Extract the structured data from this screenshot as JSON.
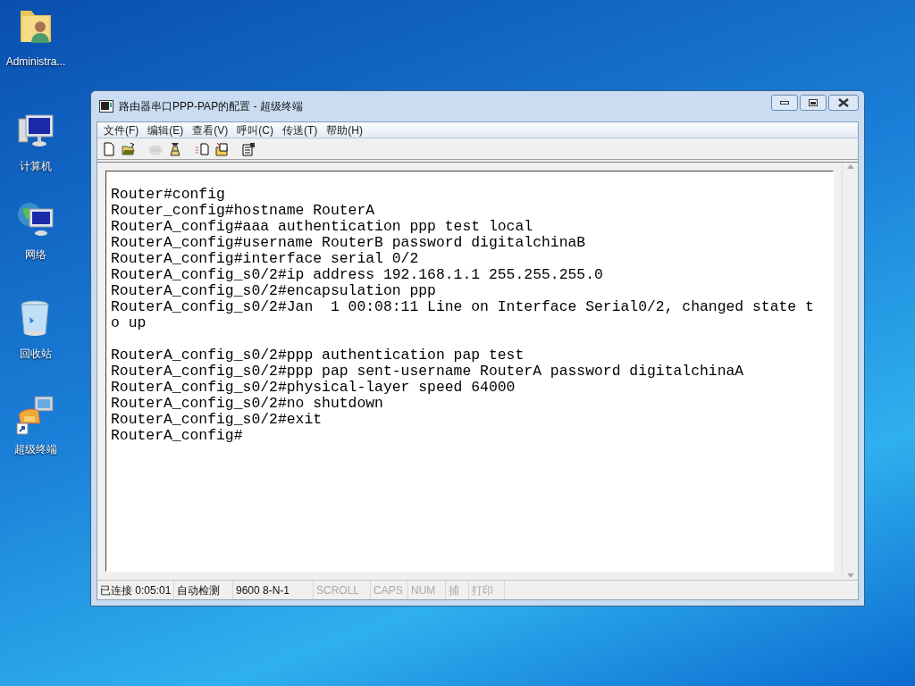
{
  "desktop_icons": [
    {
      "kind": "user-folder",
      "label": "Administra..."
    },
    {
      "kind": "computer",
      "label": "计算机"
    },
    {
      "kind": "network",
      "label": "网络"
    },
    {
      "kind": "recycle-bin",
      "label": "回收站"
    },
    {
      "kind": "terminal-shortcut",
      "label": "超级终端"
    }
  ],
  "window": {
    "title": "路由器串口PPP-PAP的配置 - 超级终端"
  },
  "menu": [
    "文件(F)",
    "编辑(E)",
    "查看(V)",
    "呼叫(C)",
    "传送(T)",
    "帮助(H)"
  ],
  "toolbar": [
    {
      "kind": "new",
      "disabled": false
    },
    {
      "kind": "open",
      "disabled": false
    },
    {
      "kind": "disconnect",
      "disabled": true
    },
    {
      "kind": "call",
      "disabled": false
    },
    {
      "kind": "send",
      "disabled": false
    },
    {
      "kind": "receive",
      "disabled": false
    },
    {
      "kind": "properties",
      "disabled": false
    }
  ],
  "terminal": {
    "lines": [
      {
        "text": "Router#config",
        "gap_before": true
      },
      {
        "text": "Router_config#hostname RouterA",
        "gap_before": false
      },
      {
        "text": "RouterA_config#aaa authentication ppp test local",
        "gap_before": false
      },
      {
        "text": "RouterA_config#username RouterB password digitalchinaB",
        "gap_before": false
      },
      {
        "text": "RouterA_config#interface serial 0/2",
        "gap_before": false
      },
      {
        "text": "RouterA_config_s0/2#ip address 192.168.1.1 255.255.255.0",
        "gap_before": false
      },
      {
        "text": "RouterA_config_s0/2#encapsulation ppp",
        "gap_before": false
      },
      {
        "text": "RouterA_config_s0/2#Jan  1 00:08:11 Line on Interface Serial0/2, changed state t",
        "gap_before": false
      },
      {
        "text": "o up",
        "gap_before": false
      },
      {
        "text": "RouterA_config_s0/2#ppp authentication pap test",
        "gap_before": true
      },
      {
        "text": "RouterA_config_s0/2#ppp pap sent-username RouterA password digitalchinaA",
        "gap_before": false
      },
      {
        "text": "RouterA_config_s0/2#physical-layer speed 64000",
        "gap_before": false
      },
      {
        "text": "RouterA_config_s0/2#no shutdown",
        "gap_before": false
      },
      {
        "text": "RouterA_config_s0/2#exit",
        "gap_before": false
      },
      {
        "text": "RouterA_config#",
        "gap_before": false
      }
    ]
  },
  "status_bar": [
    {
      "text": "已连接 0:05:01",
      "disabled": false
    },
    {
      "text": "自动检测",
      "disabled": false
    },
    {
      "text": "9600 8-N-1",
      "disabled": false
    },
    {
      "text": "SCROLL",
      "disabled": true
    },
    {
      "text": "CAPS",
      "disabled": true
    },
    {
      "text": "NUM",
      "disabled": true
    },
    {
      "text": "捕",
      "disabled": true
    },
    {
      "text": "打印",
      "disabled": true
    }
  ]
}
